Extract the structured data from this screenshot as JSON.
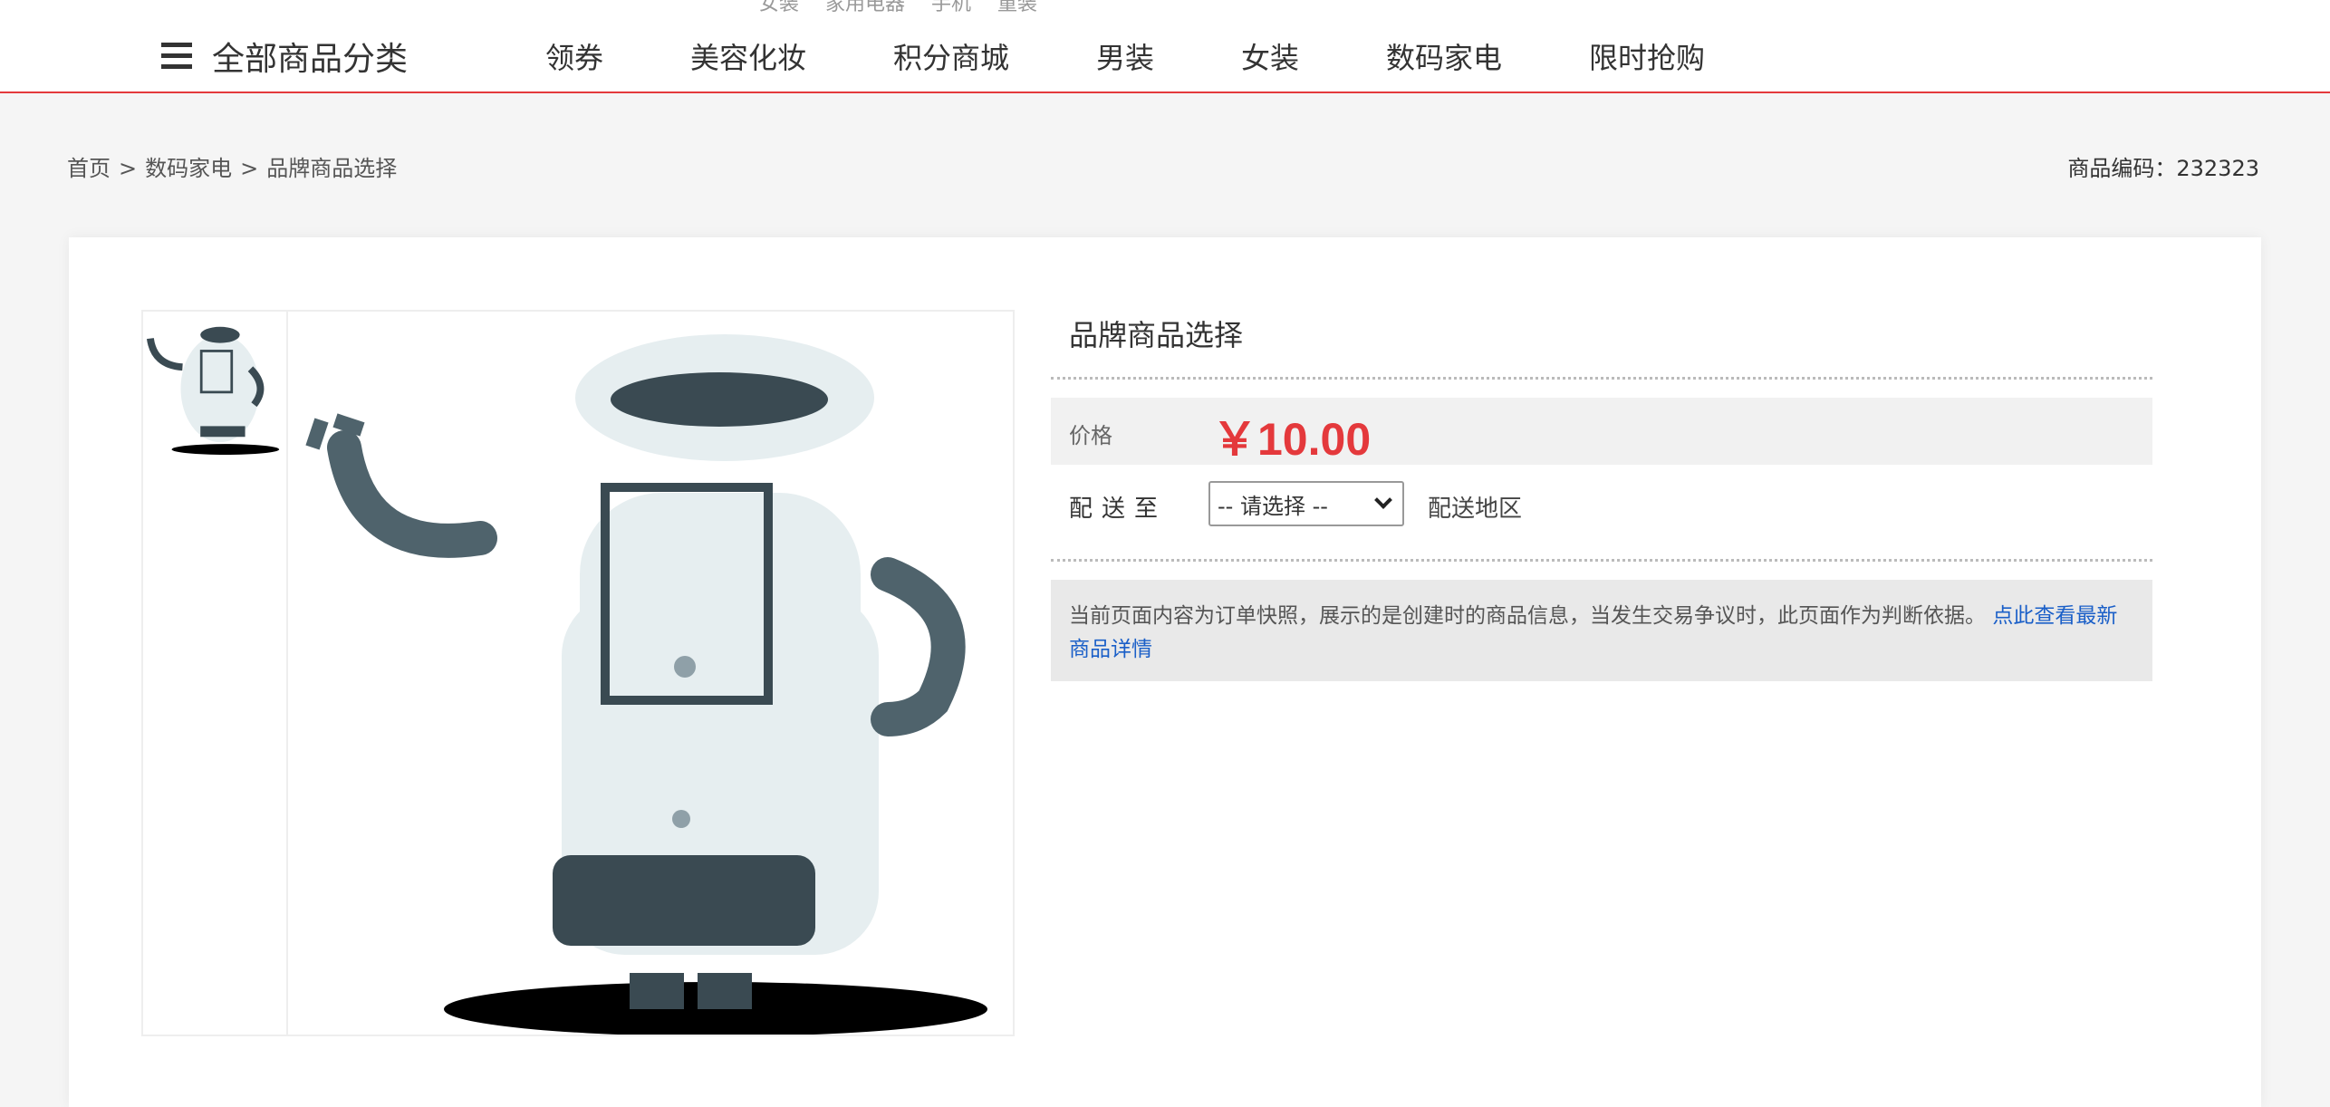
{
  "header": {
    "hot_words": [
      "女装",
      "家用电器",
      "手机",
      "童装"
    ],
    "all_categories_label": "全部商品分类",
    "nav": [
      "领券",
      "美容化妆",
      "积分商城",
      "男装",
      "女装",
      "数码家电",
      "限时抢购"
    ]
  },
  "breadcrumb": {
    "home": "首页",
    "category": "数码家电",
    "current": "品牌商品选择",
    "separator": ">"
  },
  "product_code": "商品编码：232323",
  "product": {
    "title": "品牌商品选择",
    "price_label": "价格",
    "price": "￥10.00",
    "shipping_label": "配送至",
    "shipping_select": "-- 请选择 --",
    "shipping_area_label": "配送地区",
    "notice_text": "当前页面内容为订单快照，展示的是创建时的商品信息，当发生交易争议时，此页面作为判断依据。",
    "notice_link": "点此查看最新商品详情",
    "image_name": "robot-mascot-image"
  },
  "colors": {
    "accent_red": "#e4393c",
    "link_blue": "#1a5fc8",
    "robot_body": "#e6eef0",
    "robot_dark": "#3a4a52"
  }
}
